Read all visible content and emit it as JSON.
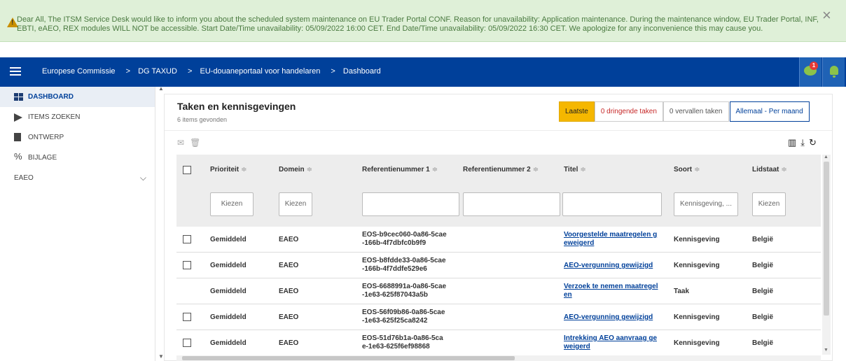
{
  "banner": {
    "text": "Dear All, The ITSM Service Desk would like to inform you about the scheduled system maintenance on EU Trader Portal CONF. Reason for unavailability: Application maintenance. During the maintenance window, EU Trader Portal, INF, EBTI, eAEO, REX modules WILL NOT be accessible. Start Date/Time unavailability: 05/09/2022 16:00 CET. End Date/Time unavailability: 05/09/2022 16:30 CET. We apologize for any inconvenience this may cause you.",
    "close": "×"
  },
  "header": {
    "breadcrumbs": [
      "Europese Commissie",
      "DG TAXUD",
      "EU-douaneportaal voor handelaren",
      "Dashboard"
    ],
    "separator": ">",
    "chat_badge": "1"
  },
  "sidebar": {
    "items": [
      {
        "label": "DASHBOARD"
      },
      {
        "label": "ITEMS ZOEKEN"
      },
      {
        "label": "ONTWERP"
      },
      {
        "label": "BIJLAGE"
      },
      {
        "label": "EAEO"
      }
    ]
  },
  "main": {
    "title": "Taken en kennisgevingen",
    "subtitle": "6 items gevonden",
    "filters": [
      "Laatste",
      "0 dringende taken",
      "0 vervallen taken",
      "Allemaal - Per maand"
    ],
    "columns": [
      "Prioriteit",
      "Domein",
      "Referentienummer 1",
      "Referentienummer 2",
      "Titel",
      "Soort",
      "Lidstaat"
    ],
    "sort_glyph": "≑",
    "column_filters": {
      "prioriteit": "Kiezen",
      "domein": "Kiezen",
      "soort": "Kennisgeving, ...",
      "lidstaat": "Kiezen"
    },
    "rows": [
      {
        "prioriteit": "Gemiddeld",
        "domein": "EAEO",
        "ref1_a": "EOS-b9cec060-0a86-5cae",
        "ref1_b": "-166b-4f7dbfc0b9f9",
        "titel_a": "Voorgestelde maatregelen g",
        "titel_b": "eweigerd",
        "soort": "Kennisgeving",
        "lidstaat": "België",
        "checkbox": true
      },
      {
        "prioriteit": "Gemiddeld",
        "domein": "EAEO",
        "ref1_a": "EOS-b8fdde33-0a86-5cae",
        "ref1_b": "-166b-4f7ddfe529e6",
        "titel_a": "AEO-vergunning gewijzigd",
        "titel_b": "",
        "soort": "Kennisgeving",
        "lidstaat": "België",
        "checkbox": true
      },
      {
        "prioriteit": "Gemiddeld",
        "domein": "EAEO",
        "ref1_a": "EOS-6688991a-0a86-5cae",
        "ref1_b": "-1e63-625f87043a5b",
        "titel_a": "Verzoek te nemen maatregel",
        "titel_b": "en",
        "soort": "Taak",
        "lidstaat": "België",
        "checkbox": false
      },
      {
        "prioriteit": "Gemiddeld",
        "domein": "EAEO",
        "ref1_a": "EOS-56f09b86-0a86-5cae",
        "ref1_b": "-1e63-625f25ca8242",
        "titel_a": "AEO-vergunning gewijzigd",
        "titel_b": "",
        "soort": "Kennisgeving",
        "lidstaat": "België",
        "checkbox": true
      },
      {
        "prioriteit": "Gemiddeld",
        "domein": "EAEO",
        "ref1_a": "EOS-51d76b1a-0a86-5ca",
        "ref1_b": "e-1e63-625f6ef98868",
        "titel_a": "Intrekking AEO aanvraag ge",
        "titel_b": "weigerd",
        "soort": "Kennisgeving",
        "lidstaat": "België",
        "checkbox": true
      }
    ]
  },
  "colors": {
    "banner_bg": "#dff0d8",
    "header_bg": "#00409a",
    "accent_yellow": "#f5b700",
    "danger_red": "#c62828",
    "link_blue": "#00409a"
  }
}
